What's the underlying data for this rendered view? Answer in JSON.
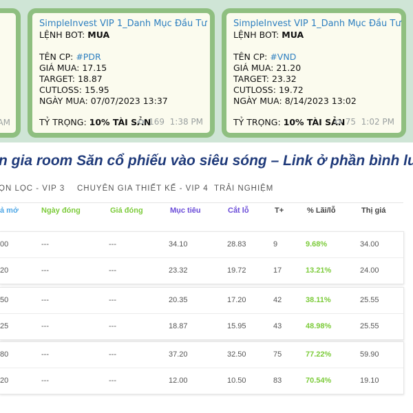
{
  "cards": [
    {
      "title": "SimpleInvest VIP 1_Danh Mục Đầu Tư",
      "bot_label": "LỆNH BOT:",
      "bot_value": "MUA",
      "ticker_label": "TÊN CP:",
      "ticker": "#PDR",
      "buy_label": "GIÁ MUA:",
      "buy": "17.15",
      "target_label": "TARGET:",
      "target": "18.87",
      "cutloss_label": "CUTLOSS:",
      "cutloss": "15.95",
      "date_label": "NGÀY MUA:",
      "date": "07/07/2023 13:37",
      "alloc_label": "TỶ TRỌNG:",
      "alloc": "10% TÀI SẢN",
      "views": "169",
      "time": "1:38 PM"
    },
    {
      "title": "SimpleInvest VIP 1_Danh Mục Đầu Tư",
      "bot_label": "LỆNH BOT:",
      "bot_value": "MUA",
      "ticker_label": "TÊN CP:",
      "ticker": "#VND",
      "buy_label": "GIÁ MUA:",
      "buy": "21.20",
      "target_label": "TARGET:",
      "target": "23.32",
      "cutloss_label": "CUTLOSS:",
      "cutloss": "19.72",
      "date_label": "NGÀY MUA:",
      "date": "8/14/2023 13:02",
      "alloc_label": "TỶ TRỌNG:",
      "alloc": "10% TÀI SẢN",
      "views": "75",
      "time": "1:02 PM"
    }
  ],
  "left_card_time_fragment": "AM",
  "banner": "n gia room Săn cổ phiếu vào siêu sóng – Link ở phần bình luận",
  "tabs": [
    "ỌN LỌC - VIP 3",
    "CHUYÊN GIA THIẾT KẾ - VIP 4",
    "TRẢI NGHIỆM"
  ],
  "columns": [
    "ả mở",
    "Ngày đóng",
    "Giá đóng",
    "Mục tiêu",
    "Cắt lỗ",
    "T+",
    "% Lãi/lỗ",
    "Thị giá"
  ],
  "colors": {
    "open_header": "#4fa7e6",
    "date_close_header": "#7ccb3a",
    "price_close_header": "#7ccb3a",
    "target_header": "#6a4bd8",
    "cutloss_header": "#6a4bd8",
    "tplus_header": "#444444",
    "pct_header": "#444444",
    "market_header": "#444444"
  },
  "rows": [
    [
      "00",
      "---",
      "---",
      "34.10",
      "28.83",
      "9",
      "9.68%",
      "34.00"
    ],
    [
      "20",
      "---",
      "---",
      "23.32",
      "19.72",
      "17",
      "13.21%",
      "24.00"
    ],
    [
      "50",
      "---",
      "---",
      "20.35",
      "17.20",
      "42",
      "38.11%",
      "25.55"
    ],
    [
      "25",
      "---",
      "---",
      "18.87",
      "15.95",
      "43",
      "48.98%",
      "25.55"
    ],
    [
      "80",
      "---",
      "---",
      "37.20",
      "32.50",
      "75",
      "77.22%",
      "59.90"
    ],
    [
      "20",
      "---",
      "---",
      "12.00",
      "10.50",
      "83",
      "70.54%",
      "19.10"
    ]
  ]
}
